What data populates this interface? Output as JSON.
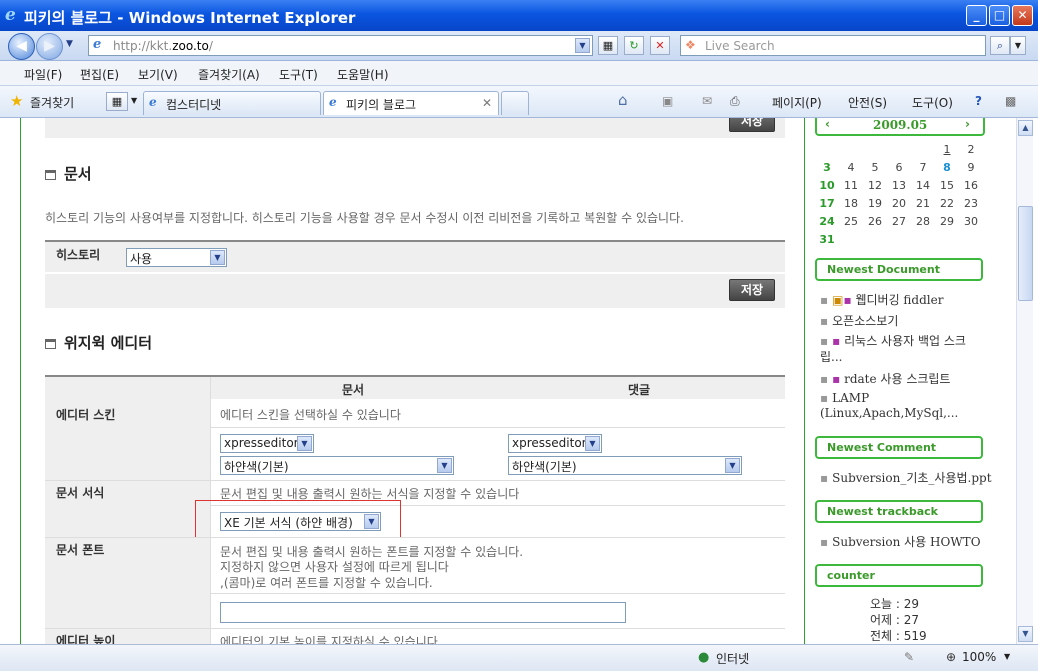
{
  "window": {
    "title": "피키의 블로그 - Windows Internet Explorer"
  },
  "address": {
    "url_prefix": "http://kkt.",
    "url_host": "zoo.to",
    "url_suffix": "/",
    "search_placeholder": "Live Search"
  },
  "menu": [
    "파일(F)",
    "편집(E)",
    "보기(V)",
    "즐겨찾기(A)",
    "도구(T)",
    "도움말(H)"
  ],
  "favorites_label": "즐겨찾기",
  "tabs": [
    {
      "label": "컴스터디넷"
    },
    {
      "label": "피키의 블로그"
    }
  ],
  "toolbar": {
    "page": "페이지(P)",
    "safety": "안전(S)",
    "tools": "도구(O)"
  },
  "top_save": "저장",
  "doc_section": {
    "title": "문서",
    "description": "히스토리 기능의 사용여부를 지정합니다. 히스토리 기능을 사용할 경우 문서 수정시 이전 리비전을 기록하고 복원할 수 있습니다.",
    "history_label": "히스토리",
    "history_value": "사용",
    "save": "저장"
  },
  "editor_section": {
    "title": "위지윅 에디터",
    "col_doc": "문서",
    "col_comment": "댓글",
    "skin_label": "에디터 스킨",
    "skin_desc": "에디터 스킨을 선택하실 수 있습니다",
    "doc_skin": "xpresseditor",
    "doc_color": "하얀색(기본)",
    "comment_skin": "xpresseditor",
    "comment_color": "하얀색(기본)",
    "style_label": "문서 서식",
    "style_desc": "문서 편집 및 내용 출력시 원하는 서식을 지정할 수 있습니다",
    "style_value": "XE 기본 서식 (하얀 배경)",
    "font_label": "문서 폰트",
    "font_desc1": "문서 편집 및 내용 출력시 원하는 폰트를 지정할 수 있습니다.",
    "font_desc2": "지정하지 않으면 사용자 설정에 따르게 됩니다",
    "font_desc3": ",(콤마)로 여러 폰트를 지정할 수 있습니다.",
    "font_value": "",
    "height_label": "에디터 높이",
    "height_desc": "에디터의 기본 높이를 지정하실 수 있습니다."
  },
  "calendar": {
    "month": "2009.05",
    "prev": "‹",
    "next": "›",
    "weeks": [
      [
        "",
        "",
        "",
        "",
        "",
        "1",
        "2"
      ],
      [
        "3",
        "4",
        "5",
        "6",
        "7",
        "8",
        "9"
      ],
      [
        "10",
        "11",
        "12",
        "13",
        "14",
        "15",
        "16"
      ],
      [
        "17",
        "18",
        "19",
        "20",
        "21",
        "22",
        "23"
      ],
      [
        "24",
        "25",
        "26",
        "27",
        "28",
        "29",
        "30"
      ],
      [
        "31",
        "",
        "",
        "",
        "",
        "",
        ""
      ]
    ]
  },
  "newest_document": {
    "title": "Newest Document",
    "items": [
      "웹디버깅 fiddler",
      "오픈소스보기",
      "리눅스 사용자 백업 스크립...",
      "rdate 사용 스크립트",
      "LAMP (Linux,Apach,MySql,..."
    ]
  },
  "newest_comment": {
    "title": "Newest Comment",
    "items": [
      "Subversion_기초_사용법.ppt"
    ]
  },
  "newest_trackback": {
    "title": "Newest trackback",
    "items": [
      "Subversion 사용 HOWTO"
    ]
  },
  "counter": {
    "title": "counter",
    "today": "오늘 : 29",
    "yesterday": "어제 : 27",
    "total": "전체 : 519"
  },
  "status": {
    "zone": "인터넷",
    "zoom": "100%"
  },
  "colors": {
    "accent_green": "#3cb83c",
    "title_blue": "#0a55e0",
    "highlight_red": "#d33"
  }
}
